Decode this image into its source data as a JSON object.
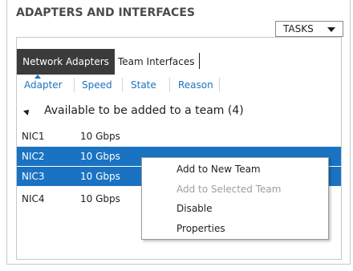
{
  "section": {
    "title": "ADAPTERS AND INTERFACES",
    "tasks_label": "TASKS"
  },
  "tabs": [
    {
      "label": "Network Adapters",
      "active": true
    },
    {
      "label": "Team Interfaces",
      "active": false
    }
  ],
  "columns": [
    "Adapter",
    "Speed",
    "State",
    "Reason"
  ],
  "group": {
    "label": "Available to be added to a team (4)"
  },
  "rows": [
    {
      "name": "NIC1",
      "speed": "10 Gbps",
      "selected": false
    },
    {
      "name": "NIC2",
      "speed": "10 Gbps",
      "selected": true
    },
    {
      "name": "NIC3",
      "speed": "10 Gbps",
      "selected": true
    },
    {
      "name": "NIC4",
      "speed": "10 Gbps",
      "selected": false
    }
  ],
  "context_menu": [
    {
      "label": "Add to New Team",
      "enabled": true
    },
    {
      "label": "Add to Selected Team",
      "enabled": false
    },
    {
      "label": "Disable",
      "enabled": true
    },
    {
      "label": "Properties",
      "enabled": true
    }
  ],
  "colors": {
    "selection": "#1a73c2",
    "header_link": "#1e73be",
    "active_tab": "#3b3b3b"
  }
}
